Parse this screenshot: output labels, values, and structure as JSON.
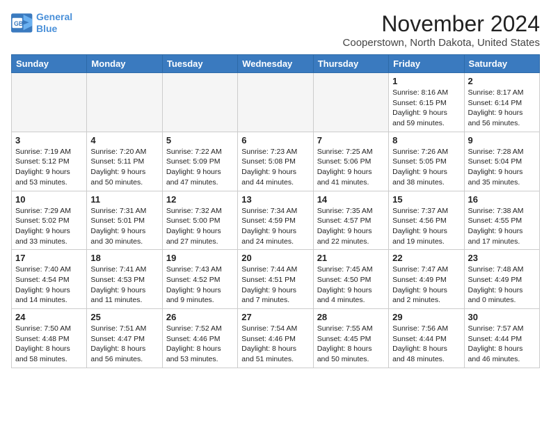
{
  "header": {
    "logo_line1": "General",
    "logo_line2": "Blue",
    "month": "November 2024",
    "location": "Cooperstown, North Dakota, United States"
  },
  "weekdays": [
    "Sunday",
    "Monday",
    "Tuesday",
    "Wednesday",
    "Thursday",
    "Friday",
    "Saturday"
  ],
  "weeks": [
    [
      {
        "day": "",
        "info": "",
        "empty": true
      },
      {
        "day": "",
        "info": "",
        "empty": true
      },
      {
        "day": "",
        "info": "",
        "empty": true
      },
      {
        "day": "",
        "info": "",
        "empty": true
      },
      {
        "day": "",
        "info": "",
        "empty": true
      },
      {
        "day": "1",
        "info": "Sunrise: 8:16 AM\nSunset: 6:15 PM\nDaylight: 9 hours and 59 minutes.",
        "empty": false
      },
      {
        "day": "2",
        "info": "Sunrise: 8:17 AM\nSunset: 6:14 PM\nDaylight: 9 hours and 56 minutes.",
        "empty": false
      }
    ],
    [
      {
        "day": "3",
        "info": "Sunrise: 7:19 AM\nSunset: 5:12 PM\nDaylight: 9 hours and 53 minutes.",
        "empty": false
      },
      {
        "day": "4",
        "info": "Sunrise: 7:20 AM\nSunset: 5:11 PM\nDaylight: 9 hours and 50 minutes.",
        "empty": false
      },
      {
        "day": "5",
        "info": "Sunrise: 7:22 AM\nSunset: 5:09 PM\nDaylight: 9 hours and 47 minutes.",
        "empty": false
      },
      {
        "day": "6",
        "info": "Sunrise: 7:23 AM\nSunset: 5:08 PM\nDaylight: 9 hours and 44 minutes.",
        "empty": false
      },
      {
        "day": "7",
        "info": "Sunrise: 7:25 AM\nSunset: 5:06 PM\nDaylight: 9 hours and 41 minutes.",
        "empty": false
      },
      {
        "day": "8",
        "info": "Sunrise: 7:26 AM\nSunset: 5:05 PM\nDaylight: 9 hours and 38 minutes.",
        "empty": false
      },
      {
        "day": "9",
        "info": "Sunrise: 7:28 AM\nSunset: 5:04 PM\nDaylight: 9 hours and 35 minutes.",
        "empty": false
      }
    ],
    [
      {
        "day": "10",
        "info": "Sunrise: 7:29 AM\nSunset: 5:02 PM\nDaylight: 9 hours and 33 minutes.",
        "empty": false
      },
      {
        "day": "11",
        "info": "Sunrise: 7:31 AM\nSunset: 5:01 PM\nDaylight: 9 hours and 30 minutes.",
        "empty": false
      },
      {
        "day": "12",
        "info": "Sunrise: 7:32 AM\nSunset: 5:00 PM\nDaylight: 9 hours and 27 minutes.",
        "empty": false
      },
      {
        "day": "13",
        "info": "Sunrise: 7:34 AM\nSunset: 4:59 PM\nDaylight: 9 hours and 24 minutes.",
        "empty": false
      },
      {
        "day": "14",
        "info": "Sunrise: 7:35 AM\nSunset: 4:57 PM\nDaylight: 9 hours and 22 minutes.",
        "empty": false
      },
      {
        "day": "15",
        "info": "Sunrise: 7:37 AM\nSunset: 4:56 PM\nDaylight: 9 hours and 19 minutes.",
        "empty": false
      },
      {
        "day": "16",
        "info": "Sunrise: 7:38 AM\nSunset: 4:55 PM\nDaylight: 9 hours and 17 minutes.",
        "empty": false
      }
    ],
    [
      {
        "day": "17",
        "info": "Sunrise: 7:40 AM\nSunset: 4:54 PM\nDaylight: 9 hours and 14 minutes.",
        "empty": false
      },
      {
        "day": "18",
        "info": "Sunrise: 7:41 AM\nSunset: 4:53 PM\nDaylight: 9 hours and 11 minutes.",
        "empty": false
      },
      {
        "day": "19",
        "info": "Sunrise: 7:43 AM\nSunset: 4:52 PM\nDaylight: 9 hours and 9 minutes.",
        "empty": false
      },
      {
        "day": "20",
        "info": "Sunrise: 7:44 AM\nSunset: 4:51 PM\nDaylight: 9 hours and 7 minutes.",
        "empty": false
      },
      {
        "day": "21",
        "info": "Sunrise: 7:45 AM\nSunset: 4:50 PM\nDaylight: 9 hours and 4 minutes.",
        "empty": false
      },
      {
        "day": "22",
        "info": "Sunrise: 7:47 AM\nSunset: 4:49 PM\nDaylight: 9 hours and 2 minutes.",
        "empty": false
      },
      {
        "day": "23",
        "info": "Sunrise: 7:48 AM\nSunset: 4:49 PM\nDaylight: 9 hours and 0 minutes.",
        "empty": false
      }
    ],
    [
      {
        "day": "24",
        "info": "Sunrise: 7:50 AM\nSunset: 4:48 PM\nDaylight: 8 hours and 58 minutes.",
        "empty": false
      },
      {
        "day": "25",
        "info": "Sunrise: 7:51 AM\nSunset: 4:47 PM\nDaylight: 8 hours and 56 minutes.",
        "empty": false
      },
      {
        "day": "26",
        "info": "Sunrise: 7:52 AM\nSunset: 4:46 PM\nDaylight: 8 hours and 53 minutes.",
        "empty": false
      },
      {
        "day": "27",
        "info": "Sunrise: 7:54 AM\nSunset: 4:46 PM\nDaylight: 8 hours and 51 minutes.",
        "empty": false
      },
      {
        "day": "28",
        "info": "Sunrise: 7:55 AM\nSunset: 4:45 PM\nDaylight: 8 hours and 50 minutes.",
        "empty": false
      },
      {
        "day": "29",
        "info": "Sunrise: 7:56 AM\nSunset: 4:44 PM\nDaylight: 8 hours and 48 minutes.",
        "empty": false
      },
      {
        "day": "30",
        "info": "Sunrise: 7:57 AM\nSunset: 4:44 PM\nDaylight: 8 hours and 46 minutes.",
        "empty": false
      }
    ]
  ]
}
